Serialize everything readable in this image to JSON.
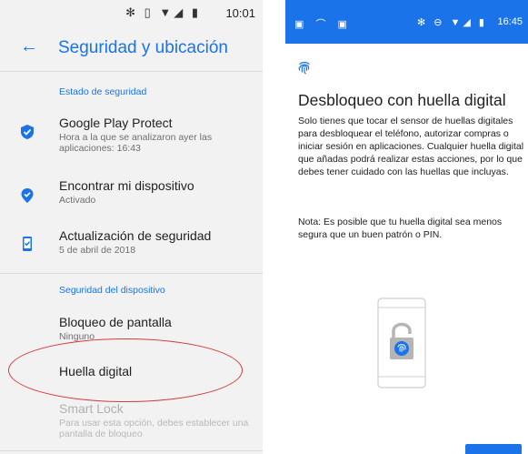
{
  "left_screen": {
    "status_bar": {
      "icons": "✻ ▯ ▼◢ ▮",
      "time": "10:01"
    },
    "app_bar": {
      "back_icon": "←",
      "title": "Seguridad y ubicación"
    },
    "sections": [
      {
        "header": "Estado de seguridad",
        "items": [
          {
            "title": "Google Play Protect",
            "subtitle": "Hora a la que se analizaron ayer las aplicaciones: 16:43",
            "icon": "shield-check-icon"
          },
          {
            "title": "Encontrar mi dispositivo",
            "subtitle": "Activado",
            "icon": "location-check-icon"
          },
          {
            "title": "Actualización de seguridad",
            "subtitle": "5 de abril de 2018",
            "icon": "phone-check-icon"
          }
        ]
      },
      {
        "header": "Seguridad del dispositivo",
        "items": [
          {
            "title": "Bloqueo de pantalla",
            "subtitle": "Ninguno"
          },
          {
            "title": "Huella digital",
            "subtitle": ""
          },
          {
            "title": "Smart Lock",
            "subtitle": "Para usar esta opción, debes establecer una pantalla de bloqueo",
            "disabled": true
          }
        ]
      }
    ]
  },
  "right_screen": {
    "status_bar": {
      "left_icons": "▣ ⌒ ▣",
      "right_icons": "✻ ⊖ ▼◢ ▮",
      "time": "16:45"
    },
    "title": "Desbloqueo con huella digital",
    "body": "Solo tienes que tocar el sensor de huellas digitales para desbloquear el teléfono, autorizar compras o iniciar sesión en aplicaciones. Cualquier huella digital que añadas podrá realizar estas acciones, por lo que debes tener cuidado con las huellas que incluyas.",
    "note": "Nota: Es posible que tu huella digital sea menos segura que un buen patrón o PIN."
  },
  "colors": {
    "accent": "#1a73e8",
    "highlight": "#d73a3a"
  }
}
